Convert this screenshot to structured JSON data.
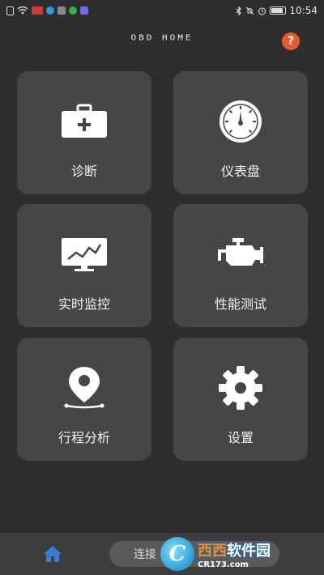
{
  "status_bar": {
    "time": "10:54",
    "left_icons": [
      "sim-icon",
      "wifi-icon",
      "app-notification-icon",
      "app-notification-icon",
      "mail-icon",
      "wechat-icon",
      "app-notification-icon"
    ],
    "right_icons": [
      "bluetooth-icon",
      "mute-icon",
      "alarm-icon",
      "battery-icon"
    ]
  },
  "header": {
    "title": "OBD HOME",
    "help_label": "?"
  },
  "tiles": [
    {
      "label": "诊断",
      "icon": "medical-kit-icon"
    },
    {
      "label": "仪表盘",
      "icon": "gauge-icon"
    },
    {
      "label": "实时监控",
      "icon": "monitor-chart-icon"
    },
    {
      "label": "性能测试",
      "icon": "engine-icon"
    },
    {
      "label": "行程分析",
      "icon": "map-pin-icon"
    },
    {
      "label": "设置",
      "icon": "gear-icon"
    }
  ],
  "bottom_bar": {
    "home_icon": "home-icon",
    "connect_label": "连接"
  },
  "watermark": {
    "logo_letter": "C",
    "main_text_a": "西西",
    "main_text_b": "软件园",
    "sub_text": "CR173.com"
  },
  "colors": {
    "background": "#2e2e2e",
    "tile": "#464646",
    "help_accent": "#e55a2f",
    "home_icon": "#3a7bd5"
  }
}
